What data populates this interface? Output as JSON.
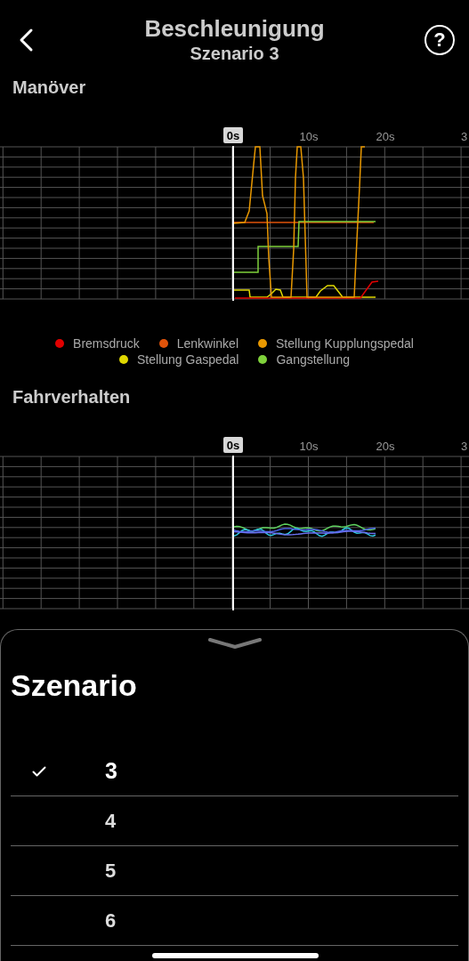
{
  "header": {
    "title": "Beschleunigung",
    "subtitle": "Szenario 3",
    "help_button": "?"
  },
  "sections": [
    {
      "title": "Manöver",
      "time_badge": "0s",
      "tick_labels": [
        "10s",
        "20s",
        "3"
      ],
      "kind": "maneuver",
      "legend": [
        {
          "label": "Bremsdruck",
          "color": "#e00000"
        },
        {
          "label": "Lenkwinkel",
          "color": "#e0530a"
        },
        {
          "label": "Stellung Kupplungspedal",
          "color": "#e89800"
        },
        {
          "label": "Stellung Gaspedal",
          "color": "#e0d800"
        },
        {
          "label": "Gangstellung",
          "color": "#7fd13b"
        }
      ]
    },
    {
      "title": "Fahrverhalten",
      "time_badge": "0s",
      "tick_labels": [
        "10s",
        "20s",
        "3"
      ],
      "kind": "behaviour"
    }
  ],
  "sheet": {
    "title": "Szenario",
    "items": [
      {
        "label": "3",
        "selected": true
      },
      {
        "label": "4",
        "selected": false
      },
      {
        "label": "5",
        "selected": false
      },
      {
        "label": "6",
        "selected": false
      }
    ]
  }
}
